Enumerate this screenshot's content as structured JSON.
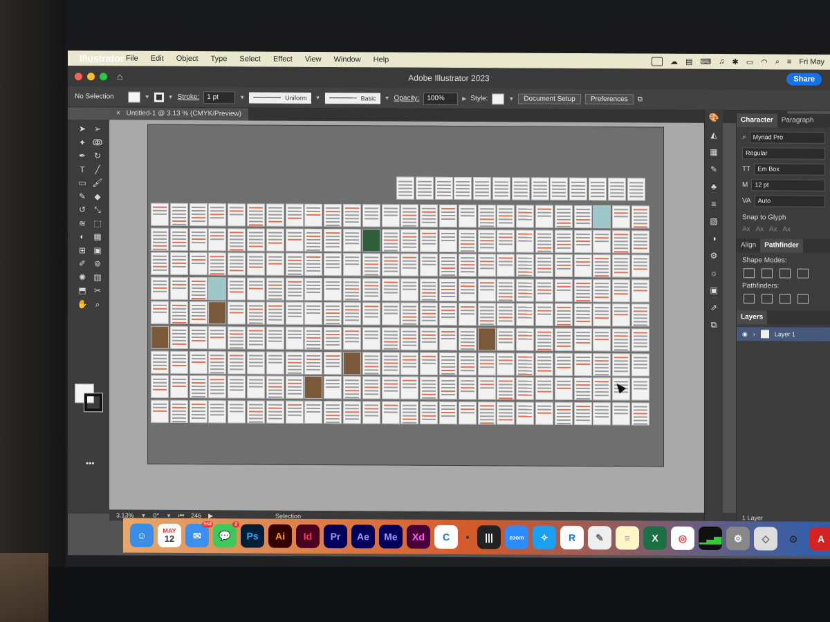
{
  "menubar": {
    "items": [
      "Illustrator",
      "File",
      "Edit",
      "Object",
      "Type",
      "Select",
      "Effect",
      "View",
      "Window",
      "Help"
    ],
    "clock": "Fri May"
  },
  "window": {
    "title": "Adobe Illustrator 2023",
    "share_label": "Share"
  },
  "controlbar": {
    "selection": "No Selection",
    "stroke_label": "Stroke:",
    "stroke_value": "1 pt",
    "profile": "Uniform",
    "brush": "Basic",
    "opacity_label": "Opacity:",
    "opacity_value": "100%",
    "style_label": "Style:",
    "document_setup": "Document Setup",
    "preferences": "Preferences"
  },
  "document_tab": {
    "close": "×",
    "label": "Untitled-1 @ 3.13 % (CMYK/Preview)"
  },
  "statusbar": {
    "zoom": "3.13%",
    "rotation": "0°",
    "artboard": "246",
    "mode": "Selection"
  },
  "panels": {
    "character": {
      "tabs": [
        "Character",
        "Paragraph"
      ],
      "font_family": "Myriad Pro",
      "font_style": "Regular",
      "em_box": "Em Box",
      "size": "12 pt",
      "leading": "Auto",
      "snap": "Snap to Glyph"
    },
    "align_tabs": [
      "Align",
      "Pathfinder"
    ],
    "shape_modes": "Shape Modes:",
    "pathfinders": "Pathfinders:",
    "layers": {
      "tab": "Layers",
      "layer_name": "Layer 1",
      "count": "1 Layer"
    }
  },
  "dock": {
    "apps": [
      "Ps",
      "Ai",
      "Id",
      "Pr",
      "Ae",
      "Me",
      "Xd",
      "zoom",
      "R",
      "X",
      "A"
    ],
    "calendar_month": "MAY",
    "calendar_day": "12",
    "mail_badge": "558",
    "messages_badge": "2"
  },
  "colors": {
    "menubar": "#e9e8cf",
    "share": "#1473e6",
    "layer_selected": "#46597a"
  }
}
